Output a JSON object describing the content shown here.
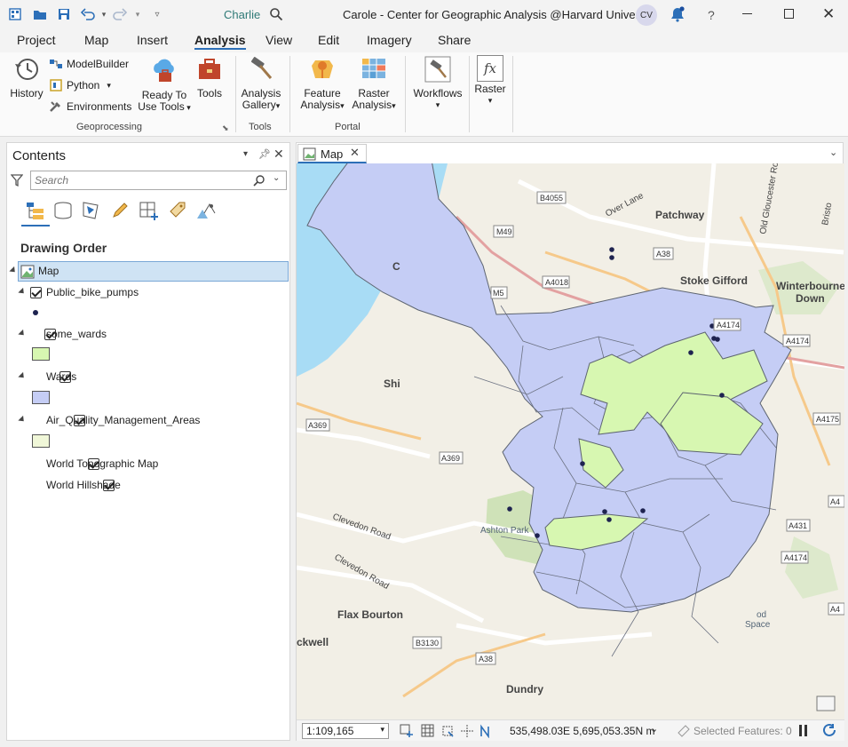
{
  "window": {
    "user": "Charlie",
    "title": "Carole - Center for Geographic Analysis @Harvard University",
    "avatar_initials": "CV",
    "help": "?"
  },
  "ribbon_tabs": [
    "Project",
    "Map",
    "Insert",
    "Analysis",
    "View",
    "Edit",
    "Imagery",
    "Share"
  ],
  "active_tab": "Analysis",
  "ribbon": {
    "history": "History",
    "modelbuilder": "ModelBuilder",
    "python": "Python",
    "environments": "Environments",
    "ready_line1": "Ready To",
    "ready_line2": "Use Tools",
    "tools": "Tools",
    "gallery_line1": "Analysis",
    "gallery_line2": "Gallery",
    "feature_line1": "Feature",
    "feature_line2": "Analysis",
    "raster_an_line1": "Raster",
    "raster_an_line2": "Analysis",
    "workflows": "Workflows",
    "raster": "Raster",
    "fx": "fx",
    "group_geoprocessing": "Geoprocessing",
    "group_tools": "Tools",
    "group_portal": "Portal"
  },
  "contents": {
    "title": "Contents",
    "search_placeholder": "Search",
    "section": "Drawing Order",
    "map_label": "Map",
    "layers": [
      "Public_bike_pumps",
      "some_wards",
      "Wards",
      "Air_Quality_Management_Areas",
      "World Topographic Map",
      "World Hillshade"
    ]
  },
  "colors": {
    "wards_fill": "#c5cdf5",
    "some_wards_fill": "#d7f7b1",
    "aqma_fill": "#f0f7d8",
    "water": "#a8dcf5",
    "point": "#1e2350",
    "accent": "#2c6fb8"
  },
  "map": {
    "tab_label": "Map",
    "labels": {
      "patchway": "Patchway",
      "stoke_gifford": "Stoke Gifford",
      "winterbourne": "Winterbourne",
      "down": "Down",
      "flax_bourton": "Flax Bourton",
      "ashton_park": "Ashton Park",
      "clevedon_road_1": "Clevedon Road",
      "clevedon_road_2": "Clevedon Road",
      "over_lane": "Over Lane",
      "old_gloucester_road": "Old Gloucester Road",
      "bristol_frag": "Bristo",
      "shi_frag": "Shi",
      "c_frag": "C",
      "ckwell_frag": "ckwell",
      "dundry_frag": "Dundry",
      "od_frag": "od",
      "space_frag": "Space"
    },
    "road_labels": [
      "B4055",
      "M49",
      "A38",
      "A4018",
      "M5",
      "A4174",
      "A4174",
      "A4175",
      "A369",
      "A369",
      "A4",
      "A431",
      "A4174",
      "A4",
      "B3130",
      "A38"
    ]
  },
  "status": {
    "scale": "1:109,165",
    "coordinates": "535,498.03E 5,695,053.35N m",
    "selected_features": "Selected Features: 0"
  }
}
